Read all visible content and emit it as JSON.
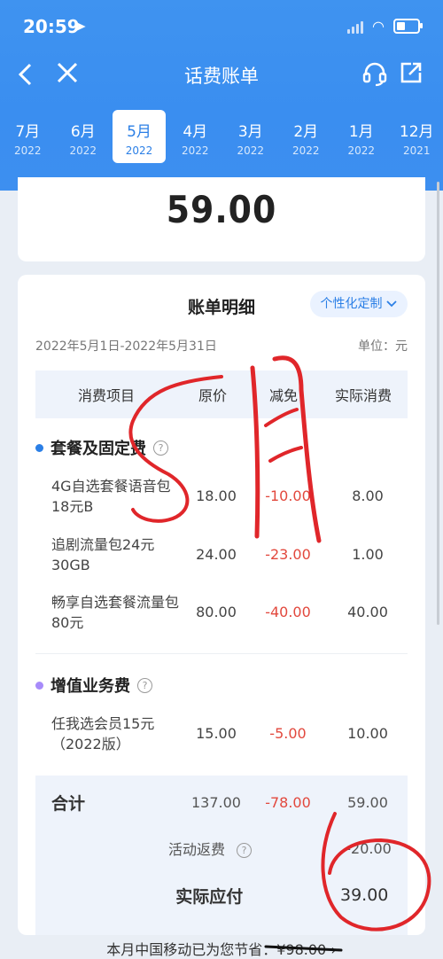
{
  "status": {
    "time": "20:59"
  },
  "nav": {
    "title": "话费账单"
  },
  "months": [
    {
      "m": "7月",
      "y": "2022"
    },
    {
      "m": "6月",
      "y": "2022"
    },
    {
      "m": "5月",
      "y": "2022"
    },
    {
      "m": "4月",
      "y": "2022"
    },
    {
      "m": "3月",
      "y": "2022"
    },
    {
      "m": "2月",
      "y": "2022"
    },
    {
      "m": "1月",
      "y": "2022"
    },
    {
      "m": "12月",
      "y": "2021"
    }
  ],
  "active_month_index": 2,
  "total": "59.00",
  "detail": {
    "title": "账单明细",
    "customize": "个性化定制",
    "period": "2022年5月1日-2022年5月31日",
    "unit": "单位：元",
    "headers": {
      "name": "消费项目",
      "orig": "原价",
      "disc": "减免",
      "actual": "实际消费"
    },
    "section1": "套餐及固定费",
    "rows1": [
      {
        "name": "4G自选套餐语音包18元B",
        "orig": "18.00",
        "disc": "-10.00",
        "actual": "8.00"
      },
      {
        "name": "追剧流量包24元30GB",
        "orig": "24.00",
        "disc": "-23.00",
        "actual": "1.00"
      },
      {
        "name": "畅享自选套餐流量包80元",
        "orig": "80.00",
        "disc": "-40.00",
        "actual": "40.00"
      }
    ],
    "section2": "增值业务费",
    "rows2": [
      {
        "name": "任我选会员15元（2022版）",
        "orig": "15.00",
        "disc": "-5.00",
        "actual": "10.00"
      }
    ],
    "sum": {
      "label": "合计",
      "orig": "137.00",
      "disc": "-78.00",
      "actual": "59.00"
    },
    "rebate": {
      "label": "活动返费",
      "value": "-20.00"
    },
    "payable": {
      "label": "实际应付",
      "value": "39.00"
    }
  },
  "saving": "本月中国移动已为您节省：¥98.00 ›",
  "colors": {
    "brand": "#3a8ef0",
    "accent": "#2b7fe6",
    "discount": "#e2483d",
    "dot1": "#2b7fe6",
    "dot2": "#a78bfa"
  }
}
